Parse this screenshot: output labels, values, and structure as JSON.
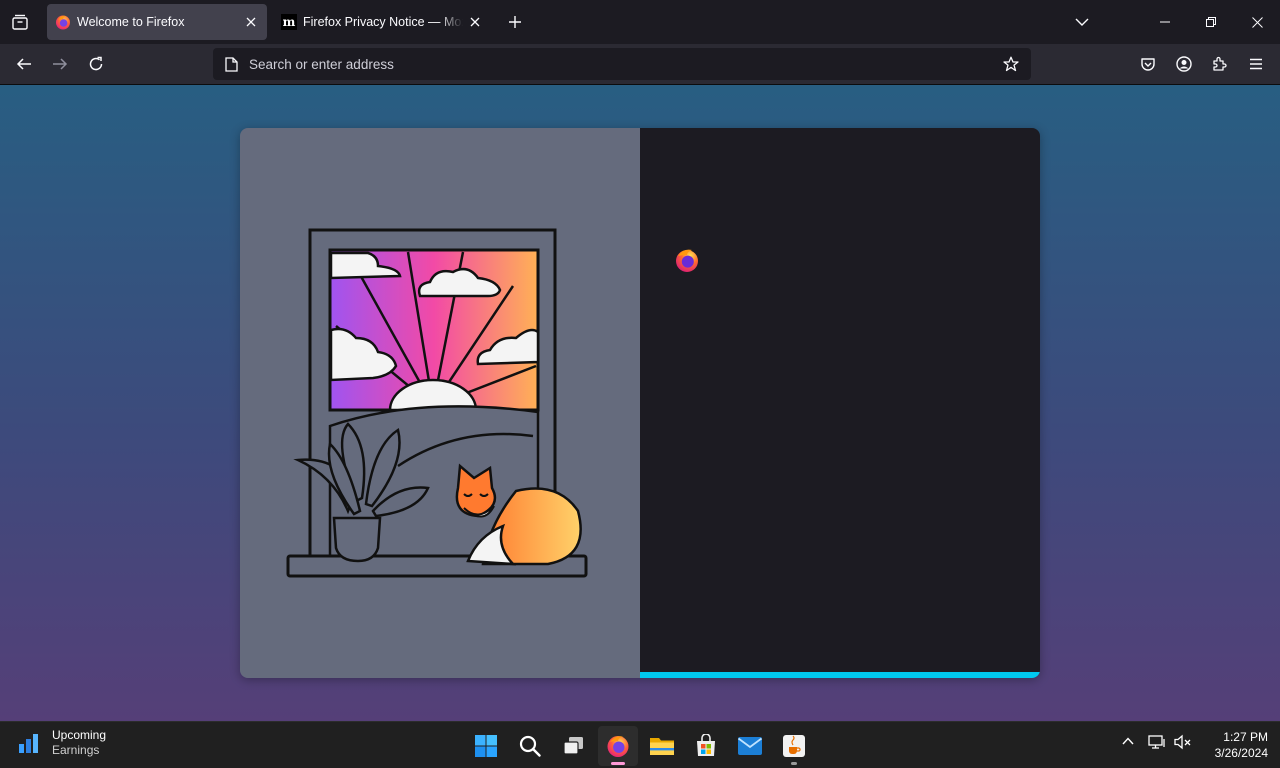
{
  "browser": {
    "tabs": [
      {
        "title": "Welcome to Firefox",
        "active": true,
        "favicon": "firefox-icon"
      },
      {
        "title": "Firefox Privacy Notice — Mozilla",
        "active": false,
        "favicon": "mozilla-m-icon"
      }
    ],
    "new_tab_icon": "plus-icon",
    "list_tabs_icon": "chevron-down-icon",
    "window_controls": [
      "minimize-icon",
      "restore-icon",
      "close-icon"
    ],
    "nav": {
      "back_icon": "back-arrow-icon",
      "forward_icon": "forward-arrow-icon",
      "reload_icon": "reload-icon",
      "address_placeholder": "Search or enter address",
      "toolbar_icons": [
        "pocket-icon",
        "account-icon",
        "extensions-icon",
        "menu-icon"
      ]
    }
  },
  "onboarding": {
    "progress": 1.0,
    "accent_color": "#00c8f0",
    "left_panel_color": "#656b7d",
    "right_panel_color": "#1c1b22"
  },
  "taskbar": {
    "widget": {
      "title": "Upcoming",
      "subtitle": "Earnings"
    },
    "apps": [
      "start-icon",
      "search-icon",
      "task-view-icon",
      "firefox-icon",
      "file-explorer-icon",
      "microsoft-store-icon",
      "mail-icon",
      "java-icon"
    ],
    "clock": {
      "time": "1:27 PM",
      "date": "3/26/2024"
    }
  }
}
